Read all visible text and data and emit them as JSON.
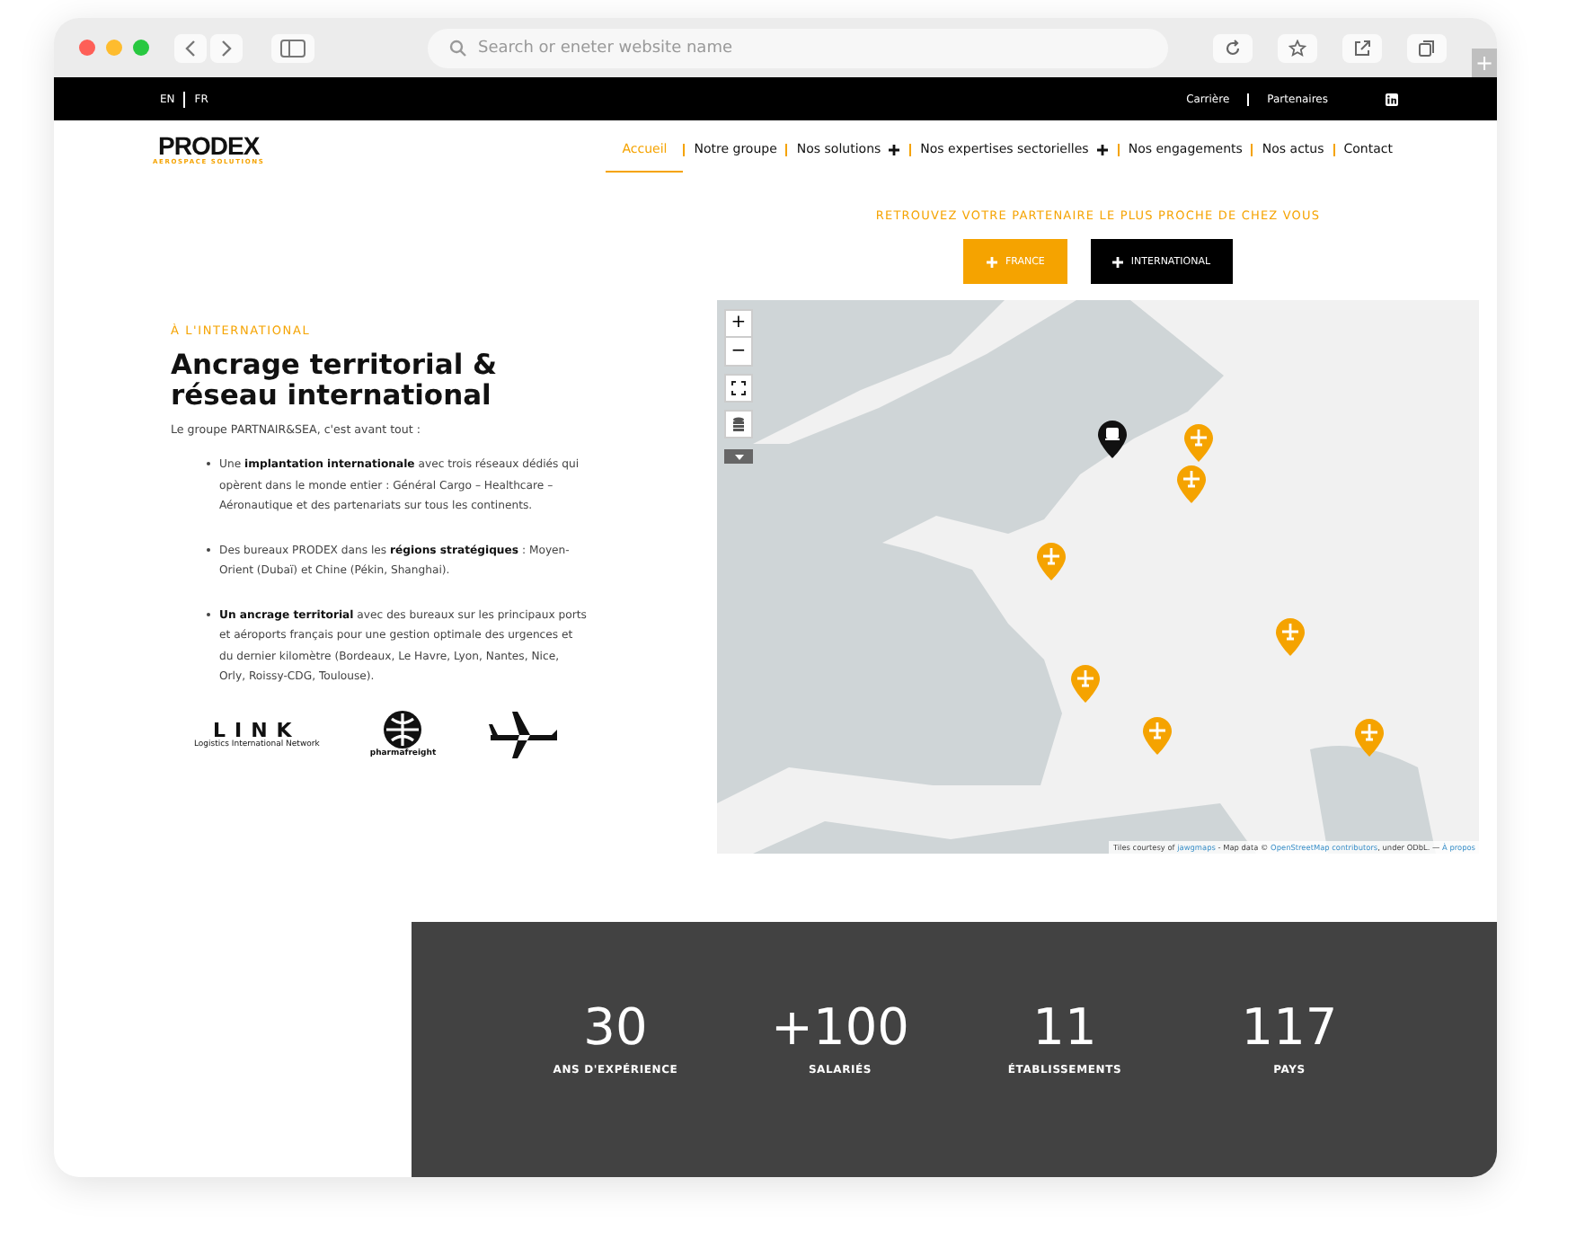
{
  "browser": {
    "address_placeholder": "Search or eneter website name",
    "new_tab": "+"
  },
  "top_bar": {
    "languages": [
      "EN",
      "FR"
    ],
    "links": [
      "Carrière",
      "Partenaires"
    ]
  },
  "logo": {
    "name": "PRODEX",
    "tagline": "AEROSPACE SOLUTIONS"
  },
  "nav": [
    {
      "label": "Accueil",
      "selected": true,
      "has_submenu": false
    },
    {
      "label": "Notre groupe",
      "selected": false,
      "has_submenu": false
    },
    {
      "label": "Nos solutions",
      "selected": false,
      "has_submenu": true
    },
    {
      "label": "Nos expertises sectorielles",
      "selected": false,
      "has_submenu": true
    },
    {
      "label": "Nos engagements",
      "selected": false,
      "has_submenu": false
    },
    {
      "label": "Nos actus",
      "selected": false,
      "has_submenu": false
    },
    {
      "label": "Contact",
      "selected": false,
      "has_submenu": false
    }
  ],
  "intro": {
    "eyebrow": "À L'INTERNATIONAL",
    "title": "Ancrage territorial & réseau international",
    "lead": "Le groupe PARTNAIR&SEA, c'est avant tout :",
    "bullets": [
      "Une **implantation internationale** avec trois réseaux dédiés qui opèrent dans le monde entier : Général Cargo – Healthcare – Aéronautique et des partenariats sur tous les continents.",
      "Des bureaux PRODEX dans les **régions stratégiques** : Moyen-Orient (Dubaï) et Chine (Pékin, Shanghai).",
      "**Un ancrage territorial** avec des bureaux sur les principaux ports et aéroports français pour une gestion optimale des urgences et du dernier kilomètre (Bordeaux, Le Havre, Lyon, Nantes, Nice, Orly, Roissy-CDG, Toulouse)."
    ]
  },
  "partner_logos": [
    {
      "kind": "link",
      "name": "LINK",
      "caption": "Logistics International Network"
    },
    {
      "kind": "pharma",
      "caption": "pharmafreight"
    },
    {
      "kind": "plane"
    }
  ],
  "finder": {
    "title": "RETROUVEZ VOTRE PARTENAIRE LE PLUS PROCHE DE CHEZ VOUS",
    "buttons": [
      {
        "label": "FRANCE",
        "selected": true
      },
      {
        "label": "INTERNATIONAL",
        "selected": false
      }
    ]
  },
  "map": {
    "zoom_in": "+",
    "zoom_out": "−",
    "markers": [
      {
        "kind": "ship"
      },
      {
        "kind": "plane"
      },
      {
        "kind": "plane"
      },
      {
        "kind": "plane"
      },
      {
        "kind": "plane"
      },
      {
        "kind": "plane"
      },
      {
        "kind": "plane"
      },
      {
        "kind": "plane"
      }
    ],
    "attribution": [
      {
        "text": "Tiles courtesy of ",
        "link": false
      },
      {
        "text": "jawgmaps",
        "link": true
      },
      {
        "text": " - Map data © ",
        "link": false
      },
      {
        "text": "OpenStreetMap contributors",
        "link": true
      },
      {
        "text": ", under ODbL. — ",
        "link": false
      },
      {
        "text": "À propos",
        "link": true
      }
    ]
  },
  "stats": [
    {
      "value": "30",
      "label": "ANS D'EXPÉRIENCE"
    },
    {
      "value": "+100",
      "label": "SALARIÉS"
    },
    {
      "value": "11",
      "label": "ÉTABLISSEMENTS"
    },
    {
      "value": "117",
      "label": "PAYS"
    }
  ]
}
